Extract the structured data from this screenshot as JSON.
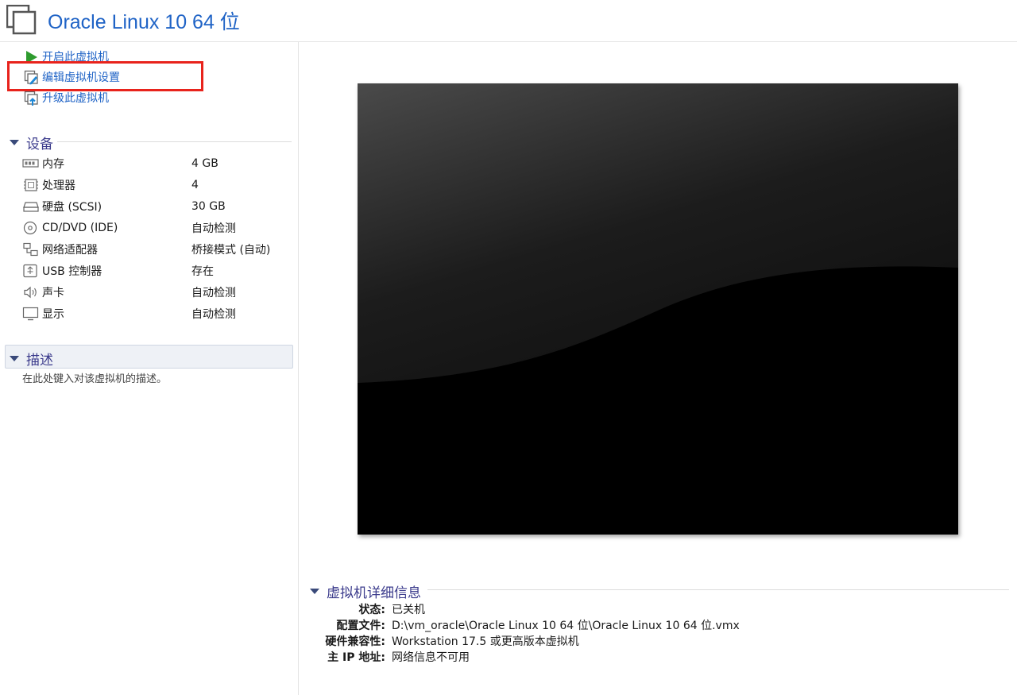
{
  "header": {
    "title": "Oracle Linux 10 64 位"
  },
  "actions": [
    {
      "label": "开启此虚拟机",
      "icon": "play-icon"
    },
    {
      "label": "编辑虚拟机设置",
      "icon": "edit-settings-icon"
    },
    {
      "label": "升级此虚拟机",
      "icon": "upgrade-icon"
    }
  ],
  "devices": {
    "title": "设备",
    "items": [
      {
        "name": "内存",
        "value": "4 GB",
        "icon": "memory-icon"
      },
      {
        "name": "处理器",
        "value": "4",
        "icon": "processor-icon"
      },
      {
        "name": "硬盘 (SCSI)",
        "value": "30 GB",
        "icon": "harddisk-icon"
      },
      {
        "name": "CD/DVD (IDE)",
        "value": "自动检测",
        "icon": "cd-icon"
      },
      {
        "name": "网络适配器",
        "value": "桥接模式 (自动)",
        "icon": "network-icon"
      },
      {
        "name": "USB 控制器",
        "value": "存在",
        "icon": "usb-icon"
      },
      {
        "name": "声卡",
        "value": "自动检测",
        "icon": "speaker-icon"
      },
      {
        "name": "显示",
        "value": "自动检测",
        "icon": "monitor-icon"
      }
    ]
  },
  "description": {
    "title": "描述",
    "placeholder": "在此处键入对该虚拟机的描述。"
  },
  "details": {
    "title": "虚拟机详细信息",
    "rows": [
      {
        "label": "状态:",
        "value": "已关机"
      },
      {
        "label": "配置文件:",
        "value": "D:\\vm_oracle\\Oracle Linux 10 64 位\\Oracle Linux 10 64 位.vmx"
      },
      {
        "label": "硬件兼容性:",
        "value": "Workstation 17.5 或更高版本虚拟机"
      },
      {
        "label": "主 IP 地址:",
        "value": "网络信息不可用"
      }
    ]
  },
  "colors": {
    "link": "#1f63c6",
    "highlight": "#e8231c",
    "section": "#3b3b8c"
  }
}
